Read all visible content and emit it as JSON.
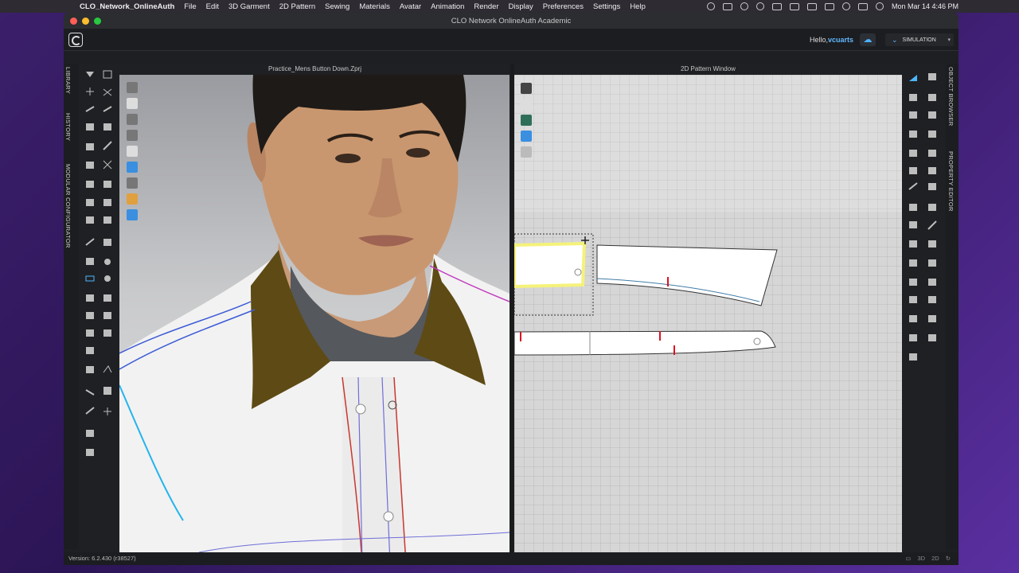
{
  "mac_menubar": {
    "app_name": "CLO_Network_OnlineAuth",
    "menus": [
      "File",
      "Edit",
      "3D Garment",
      "2D Pattern",
      "Sewing",
      "Materials",
      "Avatar",
      "Animation",
      "Render",
      "Display",
      "Preferences",
      "Settings",
      "Help"
    ],
    "clock": "Mon Mar 14  4:46 PM"
  },
  "window": {
    "title": "CLO Network OnlineAuth Academic"
  },
  "header": {
    "hello_prefix": "Hello,",
    "username": "vcuarts",
    "mode_label": "SIMULATION"
  },
  "left_tabs": [
    "LIBRARY",
    "HISTORY",
    "MODULAR CONFIGURATOR"
  ],
  "right_tabs": [
    "OBJECT BROWSER",
    "PROPERTY EDITOR"
  ],
  "viewport3d": {
    "title": "Practice_Mens Button Down.Zprj"
  },
  "pattern2d": {
    "title": "2D Pattern Window"
  },
  "statusbar": {
    "version": "Version: 6.2.430 (r38527)"
  },
  "colors": {
    "accent": "#4db6ff",
    "selection": "#f5f27a",
    "collar": "#5e4a14"
  }
}
